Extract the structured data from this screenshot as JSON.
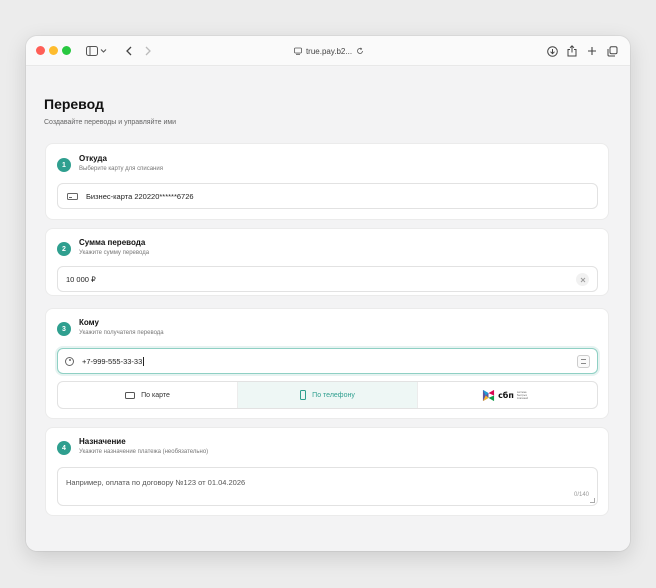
{
  "browser": {
    "url": "true.pay.b2...",
    "icons": [
      "sidebar-icon",
      "chevron-left-icon",
      "chevron-right-icon",
      "page-icon",
      "reload-icon",
      "download-icon",
      "share-icon",
      "new-tab-icon",
      "tabs-overview-icon"
    ]
  },
  "page": {
    "title": "Перевод",
    "subtitle": "Создавайте переводы и управляйте ими"
  },
  "steps": {
    "from": {
      "number": "1",
      "title": "Откуда",
      "subtitle": "Выберите карту для списания",
      "value": "Бизнес-карта 220220******6726"
    },
    "amount": {
      "number": "2",
      "title": "Сумма перевода",
      "subtitle": "Укажите сумму перевода",
      "value": "10 000 ₽"
    },
    "to": {
      "number": "3",
      "title": "Кому",
      "subtitle": "Укажите получателя перевода",
      "value": "+7-999-555-33-33",
      "methods": [
        {
          "label": "По карте",
          "active": false
        },
        {
          "label": "По телефону",
          "active": true
        }
      ],
      "sbp_text": "сбп",
      "sbp_small": "система быстрых платежей"
    },
    "purpose": {
      "number": "4",
      "title": "Назначение",
      "subtitle": "Укажите назначение платежа (необязательно)",
      "placeholder": "Например, оплата по договору №123 от 01.04.2026",
      "counter": "0/140"
    }
  },
  "colors": {
    "accent": "#2f9f8f",
    "background": "#f3f3f4"
  }
}
